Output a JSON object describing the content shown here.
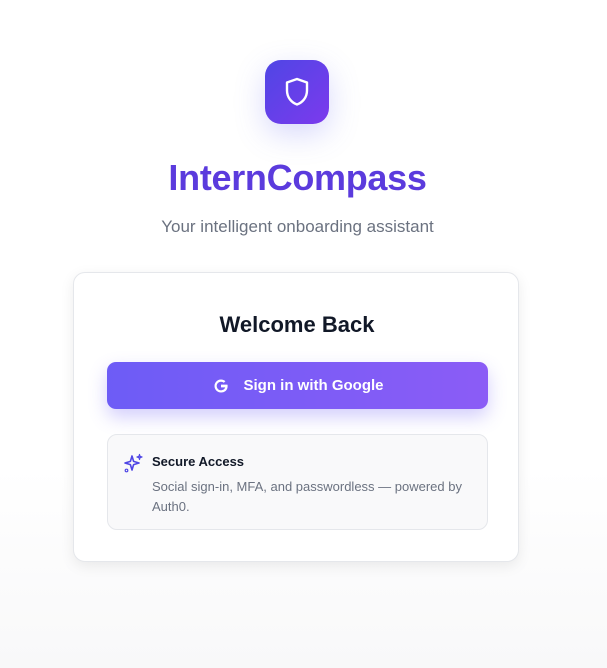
{
  "app": {
    "logo_icon": "shield-icon",
    "title": "InternCompass",
    "subtitle": "Your intelligent onboarding assistant"
  },
  "login_card": {
    "heading": "Welcome Back",
    "google_button": {
      "icon": "google-g-icon",
      "label": "Sign in with Google"
    },
    "info": {
      "icon": "sparkles-icon",
      "title": "Secure Access",
      "description": "Social sign-in, MFA, and passwordless — powered by Auth0."
    }
  },
  "colors": {
    "brand_gradient_start": "#4f46e5",
    "brand_gradient_end": "#7c3aed",
    "title_color": "#5b3bdd",
    "button_gradient_start": "#6d5cf6",
    "button_gradient_end": "#8b5cf6"
  }
}
